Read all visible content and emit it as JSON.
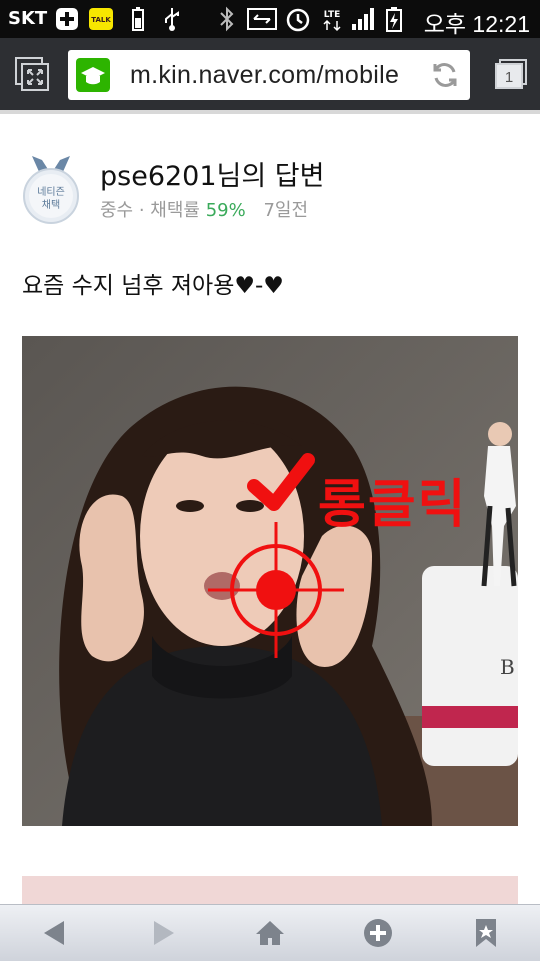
{
  "status_bar": {
    "carrier": "SKT",
    "network": "LTE",
    "time": "오후 12:21",
    "icons": [
      "plus-box-icon",
      "talk-icon",
      "battery-small-icon",
      "usb-icon",
      "bluetooth-icon",
      "screen-share-icon",
      "alarm-icon",
      "lte-icon",
      "signal-icon",
      "battery-charging-icon"
    ]
  },
  "browser": {
    "url": "m.kin.naver.com/mobile",
    "tab_count": "1",
    "icons": [
      "exit-fullscreen-icon",
      "site-icon",
      "reload-icon",
      "tabs-icon"
    ]
  },
  "answer": {
    "badge_line1": "네티즌",
    "badge_line2": "채택",
    "author": "pse6201님의 답변",
    "rank": "중수 · 채택률",
    "rate": "59%",
    "age": "7일전",
    "text": "요즘 수지 넘후 져아용♥-♥"
  },
  "overlay": {
    "label": "롱클릭",
    "color": "#f01010"
  },
  "bottom_nav": {
    "icons": [
      "back-icon",
      "forward-icon",
      "home-icon",
      "add-icon",
      "bookmark-icon"
    ]
  },
  "colors": {
    "rate_green": "#3aaa5a",
    "toolbar": "#2d2f33",
    "site_icon_green": "#2db400"
  }
}
